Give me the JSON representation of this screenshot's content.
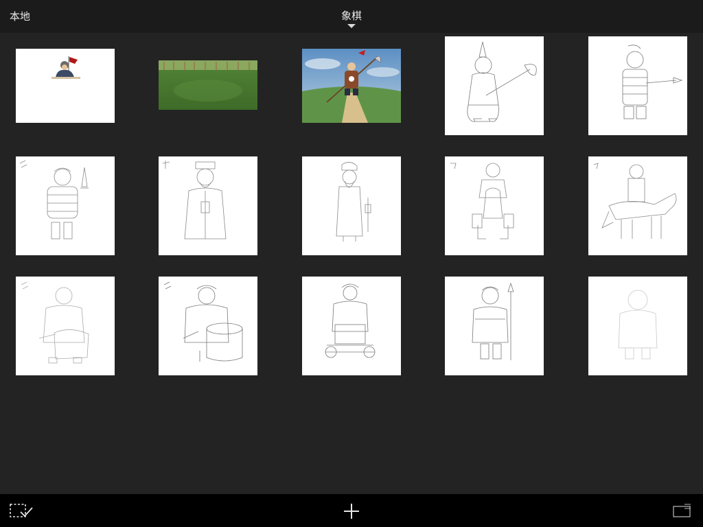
{
  "header": {
    "back_label": "本地",
    "title": "象棋"
  },
  "gallery": {
    "items": [
      {
        "content": "soldier-with-flag-small"
      },
      {
        "content": "grass-landscape"
      },
      {
        "content": "warrior-with-glaive-painting"
      },
      {
        "content": "warrior-with-glaive-sketch"
      },
      {
        "content": "soldier-with-spear-sketch"
      },
      {
        "content": "soldier-with-sword-sketch"
      },
      {
        "content": "minister-sketch"
      },
      {
        "content": "advisor-sketch"
      },
      {
        "content": "knight-on-horse-front-sketch"
      },
      {
        "content": "knight-on-horse-side-sketch"
      },
      {
        "content": "cannon-soldier-faint-sketch"
      },
      {
        "content": "drum-soldier-sketch"
      },
      {
        "content": "chariot-soldier-sketch"
      },
      {
        "content": "pawn-with-spear-sketch"
      },
      {
        "content": "blank-figure-outline"
      }
    ]
  },
  "toolbar": {
    "select_icon": "select-check-icon",
    "add_icon": "plus-icon",
    "view_icon": "layout-icon"
  },
  "colors": {
    "background": "#232323",
    "topbar": "#1b1b1b",
    "bottombar": "#000000",
    "text": "#e8e8e8"
  }
}
